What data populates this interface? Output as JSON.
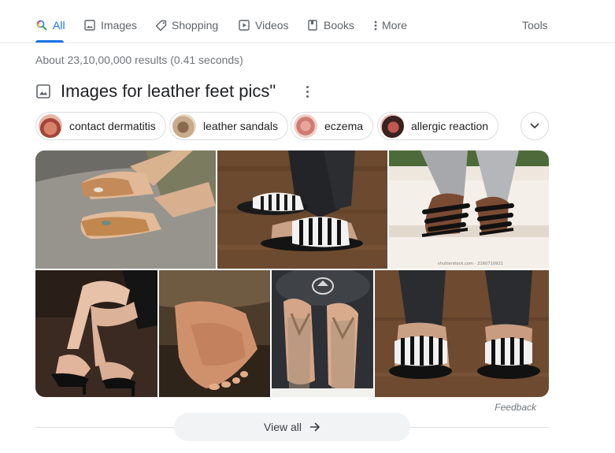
{
  "nav": {
    "tabs": [
      {
        "label": "All",
        "icon": "search-icon",
        "active": true
      },
      {
        "label": "Images",
        "icon": "image-icon"
      },
      {
        "label": "Shopping",
        "icon": "tag-icon"
      },
      {
        "label": "Videos",
        "icon": "play-icon"
      },
      {
        "label": "Books",
        "icon": "book-icon"
      },
      {
        "label": "More",
        "icon": "more-vert-icon"
      }
    ],
    "tools_label": "Tools"
  },
  "result_stats": "About 23,10,00,000 results (0.41 seconds)",
  "images_section": {
    "title": "Images for leather feet pics\"",
    "chips": [
      {
        "label": "contact dermatitis"
      },
      {
        "label": "leather sandals"
      },
      {
        "label": "eczema"
      },
      {
        "label": "allergic reaction"
      }
    ],
    "watermark": "shutterstock.com · 2160710921",
    "feedback_label": "Feedback",
    "view_all_label": "View all"
  },
  "colors": {
    "accent": "#1a73e8",
    "muted_text": "#70757a",
    "border": "#dadce0",
    "button_bg": "#f1f3f4"
  }
}
